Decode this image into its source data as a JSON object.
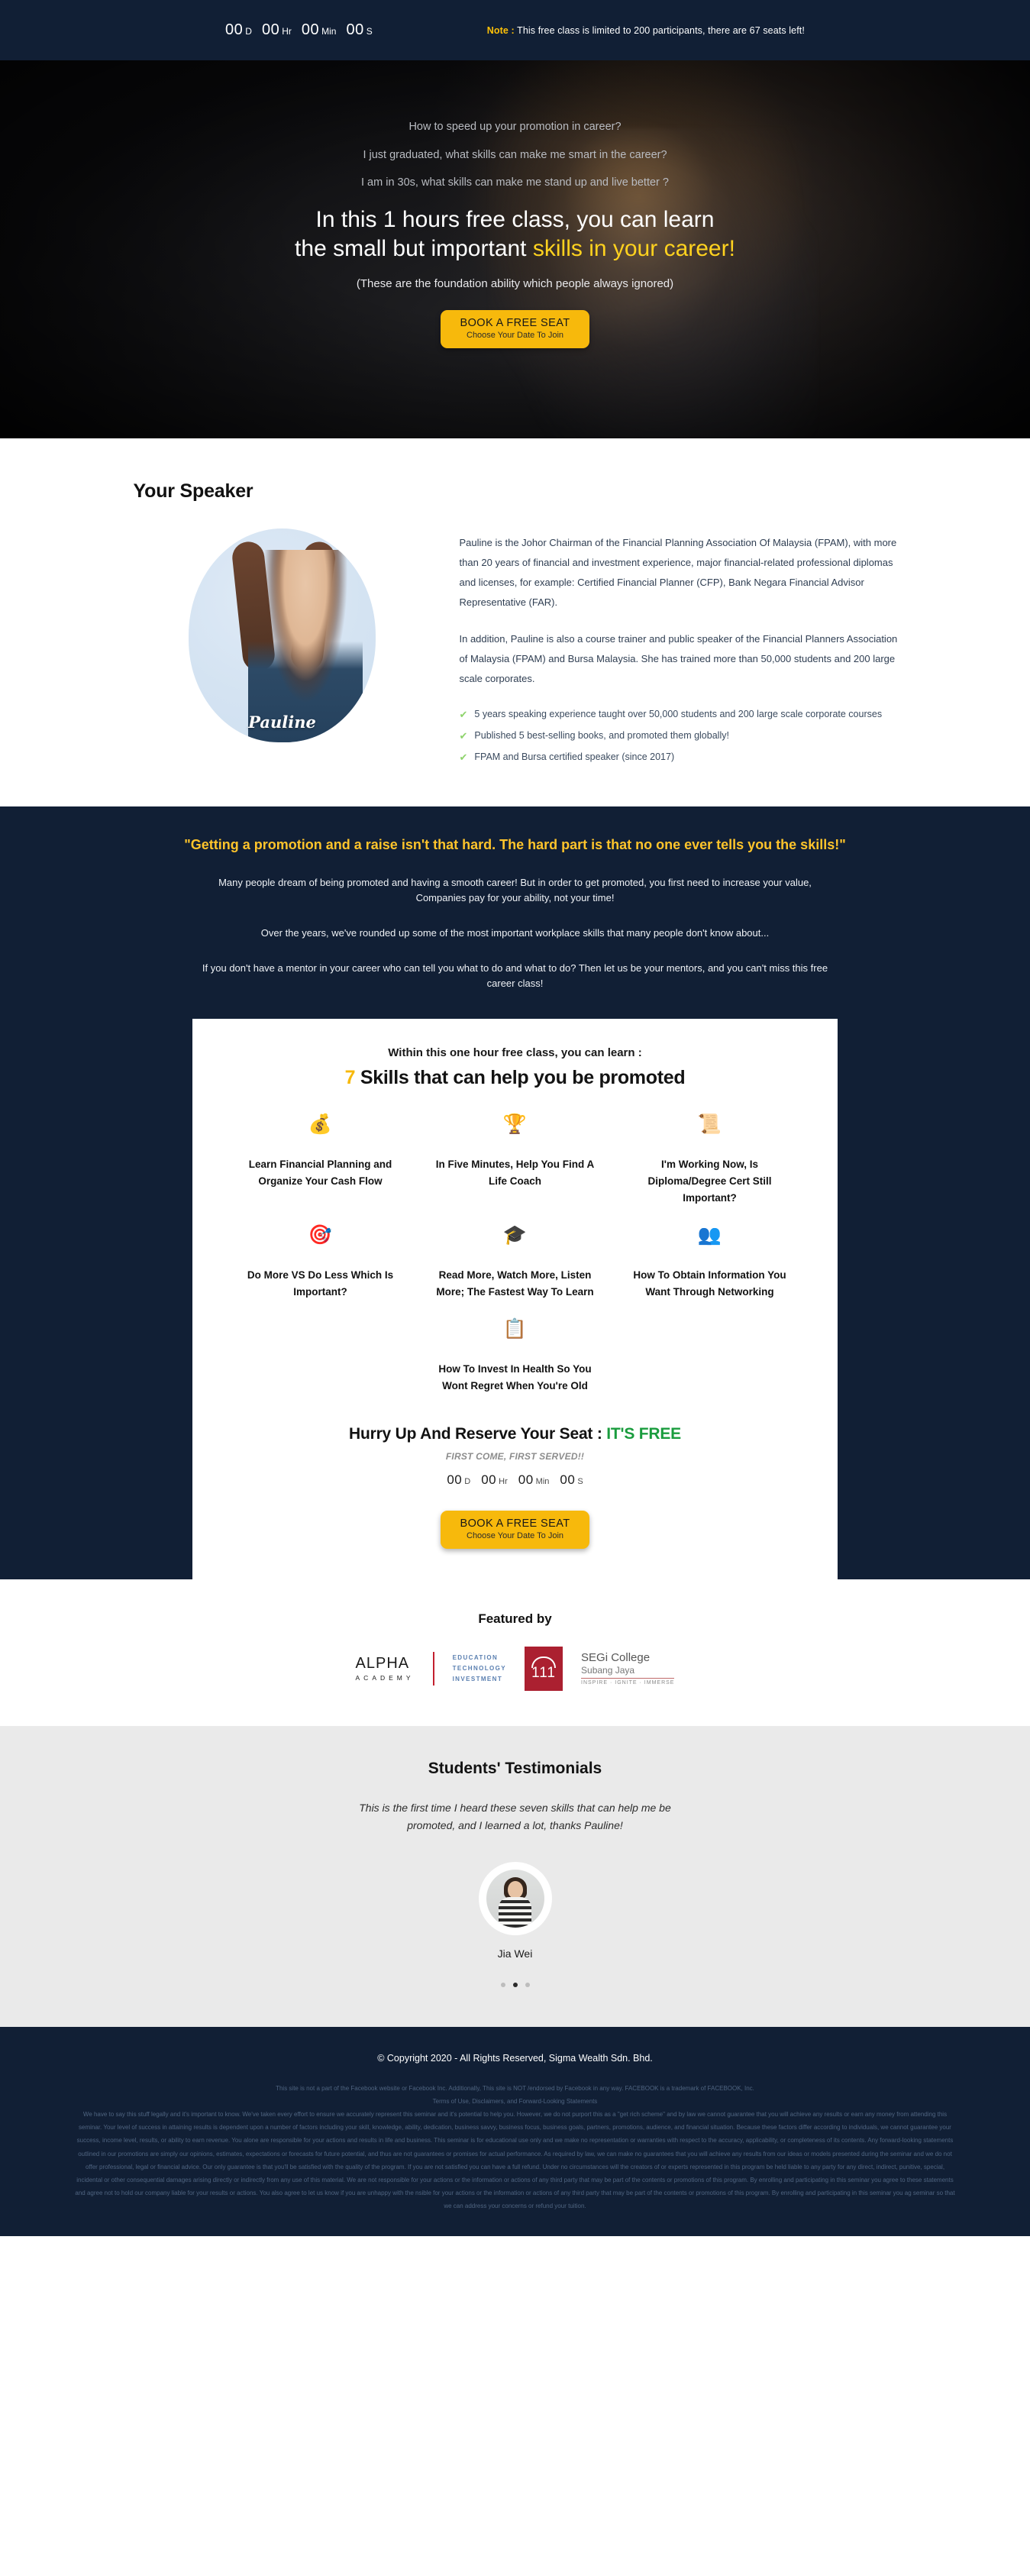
{
  "topbar": {
    "countdown": [
      {
        "value": "00",
        "unit": "D"
      },
      {
        "value": "00",
        "unit": "Hr"
      },
      {
        "value": "00",
        "unit": "Min"
      },
      {
        "value": "00",
        "unit": "S"
      }
    ],
    "note_key": "Note :",
    "note_text": " This free class is limited to 200 participants, there are 67 seats left!"
  },
  "hero": {
    "questions": [
      "How to speed up your promotion in career?",
      "I just graduated, what skills can make me smart in the career?",
      "I am in 30s, what skills can make me stand up and live better ?"
    ],
    "headline_line1": "In this 1 hours free class, you can learn",
    "headline_line2_plain": "the small but important ",
    "headline_line2_highlight": "skills in your career!",
    "subtext": "(These are the foundation ability which people always ignored)"
  },
  "cta": {
    "main": "BOOK A FREE SEAT",
    "sub": "Choose Your Date To Join"
  },
  "speaker": {
    "title": "Your Speaker",
    "signature": "Pauline",
    "bio": [
      "Pauline is the Johor Chairman of the Financial Planning Association Of Malaysia (FPAM), with more than 20 years of financial and investment experience, major financial-related professional diplomas and licenses, for example: Certified Financial Planner (CFP), Bank Negara Financial Advisor Representative (FAR).",
      "In addition, Pauline is also a course trainer and public speaker of the Financial Planners Association of Malaysia (FPAM) and Bursa Malaysia. She has trained more than 50,000 students and 200 large scale corporates."
    ],
    "bullets": [
      "5 years speaking experience taught over 50,000 students and 200 large scale corporate courses",
      "Published 5 best-selling books, and promoted them globally!",
      "FPAM and Bursa certified speaker (since 2017)"
    ]
  },
  "promo": {
    "quote": "\"Getting a promotion and a raise isn't that hard. The hard part is that no one ever tells you the skills!\"",
    "paragraphs": [
      "Many people dream of being promoted and having a smooth career! But in order to get promoted, you first need to increase your value, Companies pay for your ability, not your time!",
      "Over the years, we've rounded up some of the most important workplace skills that many people don't know about...",
      "If you don't have a mentor in your career who can tell you what to do and what to do? Then let us be your mentors, and you can't miss this free career class!"
    ]
  },
  "card": {
    "kicker": "Within this one hour free class, you can learn :",
    "title_number": "7",
    "title_rest": " Skills that can help you be promoted",
    "skills": [
      {
        "icon": "💰",
        "icon_name": "money-bag-icon",
        "label": "Learn Financial Planning and Organize Your Cash Flow"
      },
      {
        "icon": "🏆",
        "icon_name": "career-ladder-icon",
        "label": "In Five Minutes, Help You Find A Life Coach"
      },
      {
        "icon": "📜",
        "icon_name": "certificate-icon",
        "label": "I'm Working Now, Is Diploma/Degree Cert Still Important?"
      },
      {
        "icon": "🎯",
        "icon_name": "target-gear-icon",
        "label": "Do More VS Do Less Which Is Important?"
      },
      {
        "icon": "🎓",
        "icon_name": "graduation-books-icon",
        "label": "Read More, Watch More, Listen More; The Fastest Way To Learn"
      },
      {
        "icon": "👥",
        "icon_name": "networking-people-icon",
        "label": "How To Obtain Information You Want Through Networking"
      },
      {
        "icon": "📋",
        "icon_name": "health-clipboard-icon",
        "label": "How To Invest In Health So You Wont Regret When You're Old"
      }
    ],
    "hurry_text": "Hurry Up And Reserve Your Seat : ",
    "hurry_free": "IT'S FREE",
    "fcfs": "FIRST COME, FIRST SERVED!!",
    "countdown": [
      {
        "value": "00",
        "unit": "D"
      },
      {
        "value": "00",
        "unit": "Hr"
      },
      {
        "value": "00",
        "unit": "Min"
      },
      {
        "value": "00",
        "unit": "S"
      }
    ]
  },
  "featured": {
    "title": "Featured by",
    "alpha_name": "ALPHA",
    "alpha_sub": "ACADEMY",
    "alpha_tags": [
      "EDUCATION",
      "TECHNOLOGY",
      "INVESTMENT"
    ],
    "segi_pillars": "111",
    "segi_name": "SEGi College",
    "segi_city": "Subang Jaya",
    "segi_tag": "INSPIRE · IGNITE · IMMERSE"
  },
  "testimonials": {
    "title": "Students' Testimonials",
    "quote": "This is the first time I heard these seven skills that can help me be promoted, and I learned a lot, thanks Pauline!",
    "name": "Jia Wei",
    "dot_count": 3,
    "active_dot": 1
  },
  "footer": {
    "copyright": "© Copyright 2020 - All Rights Reserved, Sigma Wealth Sdn. Bhd.",
    "legal": [
      "This site is not a part of the Facebook website or Facebook Inc. Additionally, This site is NOT /endorsed by Facebook in any way. FACEBOOK is a trademark of FACEBOOK, Inc.",
      "Terms of Use, Disclaimers, and Forward-Looking Statements",
      "We have to say this stuff legally and it's important to know. We've taken every effort to ensure we accurately represent this seminar and it's potential to help you. However, we do not purport this as a \"get rich scheme\" and by law we cannot guarantee that you will achieve any results or earn any money from attending this seminar. Your level of success in attaining results is dependent upon a number of factors including your skill, knowledge, ability, dedication, business savvy, business focus, business goals, partners, promotions, audience, and financial situation. Because these factors differ according to individuals, we cannot guarantee your success, income level, results, or ability to earn revenue. You alone are responsible for your actions and results in life and business. This seminar is for educational use only and we make no representation or warranties with respect to the accuracy, applicability, or completeness of its contents. Any forward-looking statements outlined in our promotions are simply our opinions, estimates, expectations or forecasts for future potential, and thus are not guarantees or promises for actual performance. As required by law, we can make no guarantees that you will achieve any results from our ideas or models presented during the seminar and we do not offer professional, legal or financial advice. Our only guarantee is that you'll be satisfied with the quality of the program. If you are not satisfied you can have a full refund. Under no circumstances will the creators of or experts represented in this program be held liable to any party for any direct, indirect, punitive, special, incidental or other consequential damages arising directly or indirectly from any use of this material. We are not responsible for your actions or the information or actions of any third party that may be part of the contents or promotions of this program. By enrolling and participating in this seminar you agree to these statements and agree not to hold our company liable for your results or actions. You also agree to let us know if you are unhappy with the nsible for your actions or the information or actions of any third party that may be part of the contents or promotions of this program. By enrolling and participating in this seminar you ag seminar so that we can address your concerns or refund your tuition."
    ]
  }
}
